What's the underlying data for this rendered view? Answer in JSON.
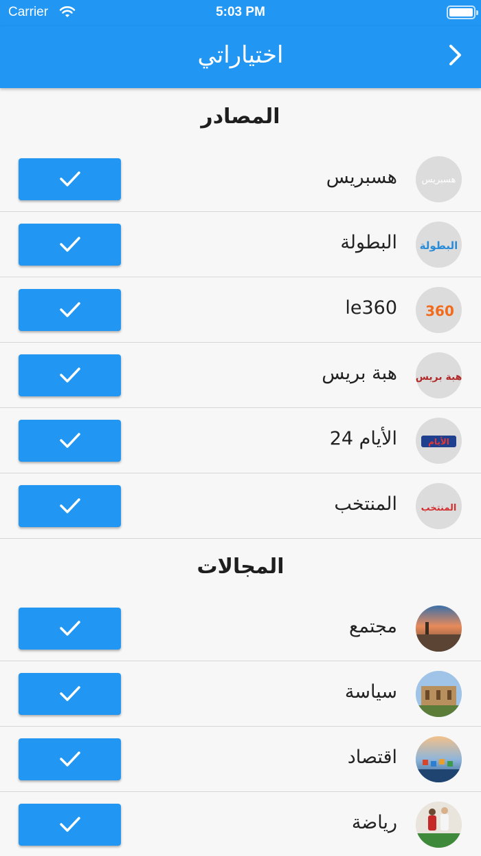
{
  "status_bar": {
    "carrier": "Carrier",
    "time": "5:03 PM"
  },
  "app_bar": {
    "title": "اختياراتي",
    "back_icon": "chevron-right-icon"
  },
  "sources_section": {
    "title": "المصادر",
    "items": [
      {
        "label": "هسبريس",
        "logo_text": "هسبريس",
        "checked": true
      },
      {
        "label": "البطولة",
        "logo_text": "البطولة",
        "checked": true
      },
      {
        "label": "le360",
        "logo_text": "360",
        "checked": true
      },
      {
        "label": "هبة بريس",
        "logo_text": "هبة بريس",
        "checked": true
      },
      {
        "label": "الأيام 24",
        "logo_text": "الأيام",
        "checked": true
      },
      {
        "label": "المنتخب",
        "logo_text": "المنتخب",
        "checked": true
      }
    ]
  },
  "categories_section": {
    "title": "المجالات",
    "items": [
      {
        "label": "مجتمع",
        "checked": true
      },
      {
        "label": "سياسة",
        "checked": true
      },
      {
        "label": "اقتصاد",
        "checked": true
      },
      {
        "label": "رياضة",
        "checked": true
      }
    ]
  },
  "colors": {
    "primary": "#2196f3",
    "background": "#f7f7f7",
    "divider": "#d6d6d6"
  }
}
